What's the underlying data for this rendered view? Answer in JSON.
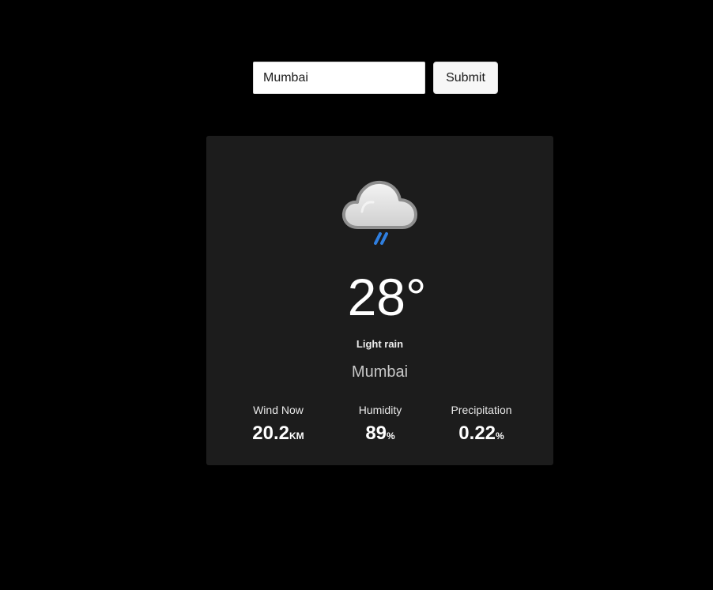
{
  "search": {
    "input_value": "Mumbai",
    "submit_label": "Submit"
  },
  "weather": {
    "icon": "cloud-rain-icon",
    "temperature": "28°",
    "condition": "Light rain",
    "city": "Mumbai",
    "stats": [
      {
        "label": "Wind Now",
        "value": "20.2",
        "unit": "KM"
      },
      {
        "label": "Humidity",
        "value": "89",
        "unit": "%"
      },
      {
        "label": "Precipitation",
        "value": "0.22",
        "unit": "%"
      }
    ]
  },
  "colors": {
    "page_background": "#000000",
    "card_background": "#1c1c1c",
    "rain_accent": "#2f7fe0"
  }
}
